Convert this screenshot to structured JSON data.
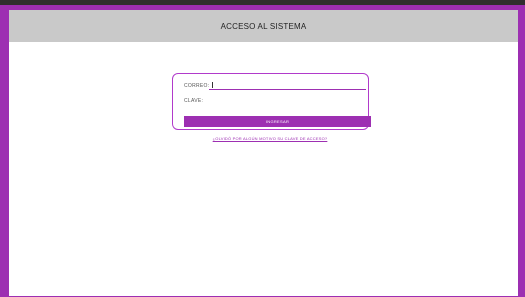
{
  "header": {
    "title": "ACCESO AL SISTEMA"
  },
  "login": {
    "email_label": "CORREO:",
    "password_label": "CLAVE:",
    "email_value": "",
    "password_value": "",
    "submit_label": "INGRESAR",
    "forgot_link": "¿OLVIDÓ POR ALGÚN MOTIVO SU CLAVE DE ACCESO?"
  },
  "colors": {
    "accent": "#9d2fb2",
    "header_bg": "#c9c9c9",
    "top_strip": "#2f2f2f"
  }
}
